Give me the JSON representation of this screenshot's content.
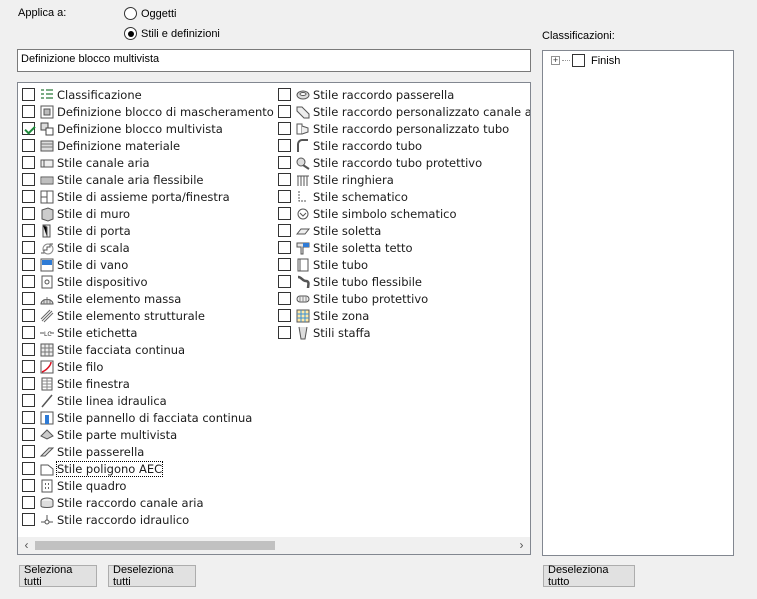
{
  "apply": {
    "label": "Applica a:",
    "options": [
      {
        "label": "Oggetti",
        "selected": false
      },
      {
        "label": "Stili e definizioni",
        "selected": true
      }
    ]
  },
  "selected_field": {
    "value": "Definizione blocco multivista"
  },
  "list": {
    "col1": [
      {
        "label": "Classificazione",
        "checked": false,
        "icon": "classification-icon"
      },
      {
        "label": "Definizione blocco di mascheramento",
        "checked": false,
        "icon": "mask-block-icon"
      },
      {
        "label": "Definizione blocco multivista",
        "checked": true,
        "icon": "multiview-block-icon"
      },
      {
        "label": "Definizione materiale",
        "checked": false,
        "icon": "material-icon"
      },
      {
        "label": "Stile canale aria",
        "checked": false,
        "icon": "duct-icon"
      },
      {
        "label": "Stile canale aria flessibile",
        "checked": false,
        "icon": "flex-duct-icon"
      },
      {
        "label": "Stile di assieme porta/finestra",
        "checked": false,
        "icon": "door-window-assembly-icon"
      },
      {
        "label": "Stile di muro",
        "checked": false,
        "icon": "wall-icon"
      },
      {
        "label": "Stile di porta",
        "checked": false,
        "icon": "door-icon"
      },
      {
        "label": "Stile di scala",
        "checked": false,
        "icon": "stair-icon"
      },
      {
        "label": "Stile di vano",
        "checked": false,
        "icon": "opening-icon"
      },
      {
        "label": "Stile dispositivo",
        "checked": false,
        "icon": "device-icon"
      },
      {
        "label": "Stile elemento massa",
        "checked": false,
        "icon": "mass-element-icon"
      },
      {
        "label": "Stile elemento strutturale",
        "checked": false,
        "icon": "structural-member-icon"
      },
      {
        "label": "Stile etichetta",
        "checked": false,
        "icon": "label-icon"
      },
      {
        "label": "Stile facciata continua",
        "checked": false,
        "icon": "curtain-wall-icon"
      },
      {
        "label": "Stile filo",
        "checked": false,
        "icon": "wire-icon"
      },
      {
        "label": "Stile finestra",
        "checked": false,
        "icon": "window-icon"
      },
      {
        "label": "Stile linea idraulica",
        "checked": false,
        "icon": "plumbing-line-icon"
      },
      {
        "label": "Stile pannello di facciata continua",
        "checked": false,
        "icon": "curtain-wall-panel-icon"
      },
      {
        "label": "Stile parte multivista",
        "checked": false,
        "icon": "multiview-part-icon"
      },
      {
        "label": "Stile passerella",
        "checked": false,
        "icon": "cable-tray-icon"
      },
      {
        "label": "Stile poligono AEC",
        "checked": false,
        "icon": "aec-polygon-icon",
        "focused": true
      },
      {
        "label": "Stile quadro",
        "checked": false,
        "icon": "panel-icon"
      },
      {
        "label": "Stile raccordo canale aria",
        "checked": false,
        "icon": "duct-fitting-icon"
      },
      {
        "label": "Stile raccordo idraulico",
        "checked": false,
        "icon": "plumbing-fitting-icon"
      }
    ],
    "col2": [
      {
        "label": "Stile raccordo passerella",
        "checked": false,
        "icon": "cable-tray-fitting-icon"
      },
      {
        "label": "Stile raccordo personalizzato canale aria",
        "checked": false,
        "icon": "custom-duct-fitting-icon"
      },
      {
        "label": "Stile raccordo personalizzato tubo",
        "checked": false,
        "icon": "custom-pipe-fitting-icon"
      },
      {
        "label": "Stile raccordo tubo",
        "checked": false,
        "icon": "pipe-fitting-icon"
      },
      {
        "label": "Stile raccordo tubo protettivo",
        "checked": false,
        "icon": "conduit-fitting-icon"
      },
      {
        "label": "Stile ringhiera",
        "checked": false,
        "icon": "railing-icon"
      },
      {
        "label": "Stile schematico",
        "checked": false,
        "icon": "schematic-icon"
      },
      {
        "label": "Stile simbolo schematico",
        "checked": false,
        "icon": "schematic-symbol-icon"
      },
      {
        "label": "Stile soletta",
        "checked": false,
        "icon": "slab-icon"
      },
      {
        "label": "Stile soletta tetto",
        "checked": false,
        "icon": "roof-slab-icon"
      },
      {
        "label": "Stile tubo",
        "checked": false,
        "icon": "pipe-icon"
      },
      {
        "label": "Stile tubo flessibile",
        "checked": false,
        "icon": "flex-pipe-icon"
      },
      {
        "label": "Stile tubo protettivo",
        "checked": false,
        "icon": "conduit-icon"
      },
      {
        "label": "Stile zona",
        "checked": false,
        "icon": "zone-icon"
      },
      {
        "label": "Stili staffa",
        "checked": false,
        "icon": "hanger-icon"
      }
    ]
  },
  "buttons": {
    "select_all": "Seleziona tutti",
    "deselect_all": "Deseleziona tutti",
    "deselect_all_class": "Deseleziona tutto"
  },
  "classifications": {
    "label": "Classificazioni:",
    "items": [
      {
        "label": "Finish",
        "checked": false,
        "expander": "+"
      }
    ]
  }
}
